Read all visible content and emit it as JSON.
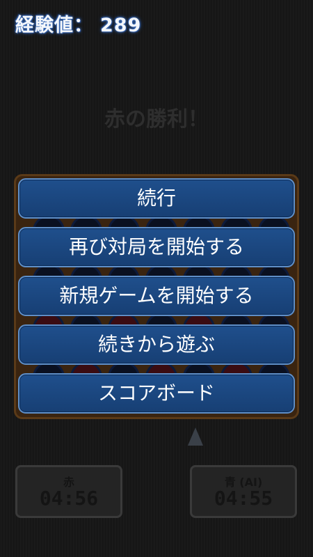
{
  "hud": {
    "xp_label": "経験値：",
    "xp_value": "289"
  },
  "result_text": "赤の勝利！",
  "menu": {
    "items": [
      {
        "label": "続行"
      },
      {
        "label": "再び対局を開始する"
      },
      {
        "label": "新規ゲームを開始する"
      },
      {
        "label": "続きから遊ぶ"
      },
      {
        "label": "スコアボード"
      }
    ]
  },
  "timers": {
    "red": {
      "name": "赤",
      "time": "04:56"
    },
    "blue": {
      "name": "青 (AI)",
      "time": "04:55"
    }
  },
  "colors": {
    "button_fill": "#1f4f8c",
    "button_border": "#5f8fc8",
    "xp_glow": "#4a7bc6"
  },
  "icons": {
    "turn_indicator": "triangle-up-icon"
  }
}
